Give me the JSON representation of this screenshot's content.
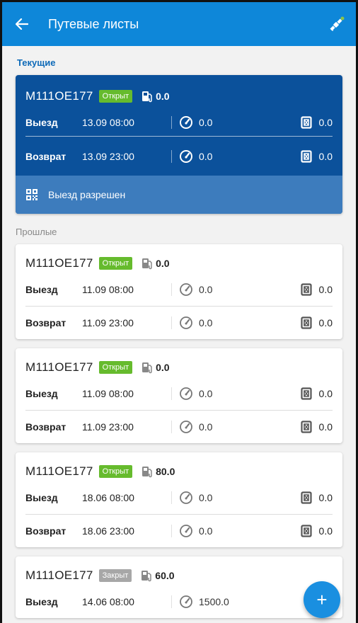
{
  "appbar": {
    "title": "Путевые листы"
  },
  "sections": {
    "current": "Текущие",
    "past": "Прошлые"
  },
  "current": {
    "plate": "М111ОЕ177",
    "status": "Открыт",
    "fuel": "0.0",
    "rows": [
      {
        "label": "Выезд",
        "datetime": "13.09 08:00",
        "odometer": "0.0",
        "fuel": "0.0"
      },
      {
        "label": "Возврат",
        "datetime": "13.09 23:00",
        "odometer": "0.0",
        "fuel": "0.0"
      }
    ],
    "allowed": "Выезд разрешен"
  },
  "past": [
    {
      "plate": "М111ОЕ177",
      "status": "Открыт",
      "fuel": "0.0",
      "rows": [
        {
          "label": "Выезд",
          "datetime": "11.09 08:00",
          "odometer": "0.0",
          "fuel": "0.0"
        },
        {
          "label": "Возврат",
          "datetime": "11.09 23:00",
          "odometer": "0.0",
          "fuel": "0.0"
        }
      ]
    },
    {
      "plate": "М111ОЕ177",
      "status": "Открыт",
      "fuel": "0.0",
      "rows": [
        {
          "label": "Выезд",
          "datetime": "11.09 08:00",
          "odometer": "0.0",
          "fuel": "0.0"
        },
        {
          "label": "Возврат",
          "datetime": "11.09 23:00",
          "odometer": "0.0",
          "fuel": "0.0"
        }
      ]
    },
    {
      "plate": "М111ОЕ177",
      "status": "Открыт",
      "fuel": "80.0",
      "rows": [
        {
          "label": "Выезд",
          "datetime": "18.06 08:00",
          "odometer": "0.0",
          "fuel": "0.0"
        },
        {
          "label": "Возврат",
          "datetime": "18.06 23:00",
          "odometer": "0.0",
          "fuel": "0.0"
        }
      ]
    },
    {
      "plate": "М111ОЕ177",
      "status": "Закрыт",
      "fuel": "60.0",
      "rows": [
        {
          "label": "Выезд",
          "datetime": "14.06 08:00",
          "odometer": "1500.0",
          "fuel": ""
        }
      ]
    }
  ],
  "fab": {
    "label": "+"
  },
  "colors": {
    "primary": "#0e87d9",
    "current_card": "#0b519b",
    "open_badge": "#66bb2d",
    "closed_badge": "#a7a7a7",
    "sat_dot": "#8bc34a"
  },
  "icons": [
    "back-arrow-icon",
    "satellite-icon",
    "fuel-pump-icon",
    "speedometer-icon",
    "fuel-canister-icon",
    "qr-code-icon",
    "plus-icon"
  ]
}
